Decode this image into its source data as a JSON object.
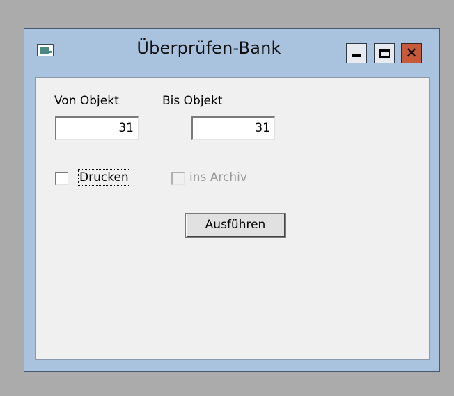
{
  "window": {
    "title": "Überprüfen-Bank",
    "icon": "app-window-icon",
    "controls": {
      "minimize": "minimize-icon",
      "maximize": "maximize-icon",
      "close": "close-icon",
      "close_color": "#c85a3c"
    }
  },
  "form": {
    "from_label": "Von Objekt",
    "from_value": "31",
    "to_label": "Bis Objekt",
    "to_value": "31",
    "print_label": "Drucken",
    "print_checked": false,
    "archive_label": "ins Archiv",
    "archive_checked": false,
    "archive_enabled": false,
    "run_button": "Ausführen"
  }
}
